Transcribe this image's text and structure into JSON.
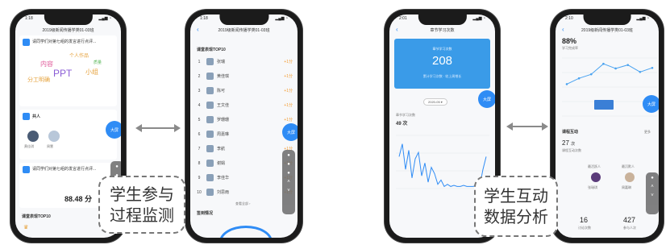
{
  "phone1": {
    "status_time": "1:18",
    "header_title": "2019级新闻传播学类01-03班",
    "item1_text": "请同学们对第七组的发言进行点评...",
    "wordcloud": [
      {
        "text": "个人作品",
        "color": "#e6a23c"
      },
      {
        "text": "内容",
        "color": "#e05a9a"
      },
      {
        "text": "PPT",
        "color": "#8a5cd6"
      },
      {
        "text": "小组",
        "color": "#e6a23c"
      },
      {
        "text": "分工明确",
        "color": "#e6a23c"
      },
      {
        "text": "质量",
        "color": "#5cb85c"
      }
    ],
    "item2_title": "共人",
    "user1": "黄佳琪",
    "user2": "周慧",
    "item3_text": "请同学们对第七组的发言进行点评...",
    "score": "88.48 分",
    "rank_title": "课堂表现TOP10",
    "fab_label": "大屏"
  },
  "phone2": {
    "status_time": "1:18",
    "header_title": "2019级新闻传播学类01-03班",
    "rank_title": "课堂表现TOP10",
    "rows": [
      {
        "no": "1",
        "name": "张瑞",
        "score": "+1分"
      },
      {
        "no": "2",
        "name": "黄佳琪",
        "score": "+1分"
      },
      {
        "no": "3",
        "name": "陈可",
        "score": "+1分"
      },
      {
        "no": "4",
        "name": "王文佳",
        "score": "+1分"
      },
      {
        "no": "5",
        "name": "罗珊珊",
        "score": "+1分"
      },
      {
        "no": "6",
        "name": "周嘉琳",
        "score": "+1分"
      },
      {
        "no": "7",
        "name": "李航",
        "score": "+1分"
      },
      {
        "no": "8",
        "name": "谢娟",
        "score": "+1分"
      },
      {
        "no": "9",
        "name": "李佳华",
        "score": "+1分"
      },
      {
        "no": "10",
        "name": "刘思雨",
        "score": "+1分"
      }
    ],
    "more": "查看全部 ›",
    "section2": "签到情况",
    "fab_label": "大屏"
  },
  "phone3": {
    "status_time": "2:01",
    "header_title": "章节学习次数",
    "banner_label": "章节学习次数",
    "banner_value": "208",
    "banner_sub": "累计学习次数 · 较上周增长",
    "date_label": "2020-05 ▾",
    "chart_title": "章节学习次数",
    "chart_value": "49 次",
    "fab_label": "大屏"
  },
  "phone4": {
    "status_time": "2:10",
    "header_title": "2019级新闻传播学类01-03班",
    "percent": "88%",
    "percent_label": "学习完成率",
    "section_title": "课程互动",
    "section_more": "更多",
    "count": "27",
    "count_unit": "次",
    "count_label": "课程互动次数",
    "person1_role": "最活跃人",
    "person2_role": "最沉默人",
    "person1_name": "张瑞琪",
    "person2_name": "周嘉琳",
    "stat1": "16",
    "stat1_label": "讨论次数",
    "stat2": "427",
    "stat2_label": "参与人次",
    "fab_label": "大屏"
  },
  "labels": {
    "left_line1": "学生参与",
    "left_line2": "过程监测",
    "right_line1": "学生互动",
    "right_line2": "数据分析"
  },
  "chart_data": {
    "type": "line",
    "title": "",
    "xlabel": "",
    "ylabel": "",
    "x": [
      1,
      2,
      3,
      4,
      5,
      6,
      7,
      8,
      9,
      10,
      11,
      12,
      13,
      14,
      15,
      16,
      17,
      18,
      19,
      20,
      21,
      22,
      23,
      24,
      25,
      26,
      27,
      28
    ],
    "series": [
      {
        "values": [
          30,
          42,
          18,
          36,
          10,
          28,
          34,
          12,
          24,
          6,
          20,
          14,
          4,
          8,
          2,
          4,
          2,
          3,
          2,
          2,
          3,
          2,
          2,
          2,
          3,
          2,
          18,
          30
        ]
      }
    ],
    "ylim": [
      0,
      50
    ]
  },
  "chart_data_2": {
    "type": "line",
    "series": [
      {
        "values": [
          55,
          65,
          72,
          90,
          82,
          88,
          76,
          83
        ]
      }
    ],
    "ylim": [
      0,
      100
    ]
  }
}
